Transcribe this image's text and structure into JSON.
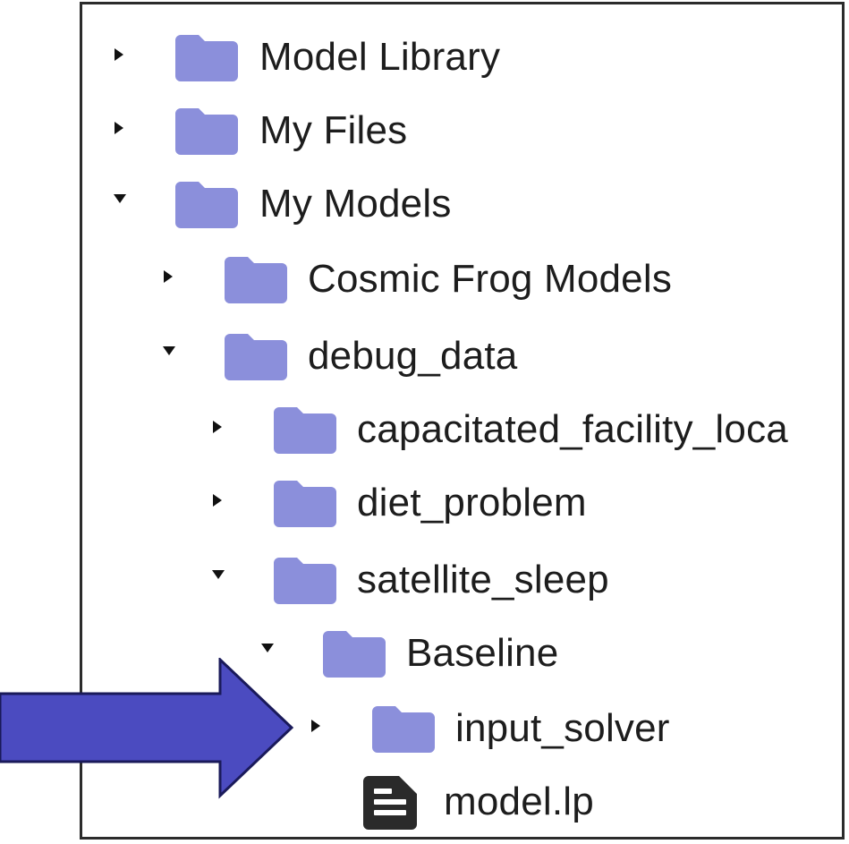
{
  "tree": {
    "items": [
      {
        "label": "Model Library",
        "icon": "folder-icon",
        "expanded": false
      },
      {
        "label": "My Files",
        "icon": "folder-icon",
        "expanded": false
      },
      {
        "label": "My Models",
        "icon": "folder-icon",
        "expanded": true
      },
      {
        "label": "Cosmic Frog Models",
        "icon": "folder-icon",
        "expanded": false
      },
      {
        "label": "debug_data",
        "icon": "folder-icon",
        "expanded": true
      },
      {
        "label": "capacitated_facility_loca",
        "icon": "folder-icon",
        "expanded": false
      },
      {
        "label": "diet_problem",
        "icon": "folder-icon",
        "expanded": false
      },
      {
        "label": "satellite_sleep",
        "icon": "folder-icon",
        "expanded": true
      },
      {
        "label": "Baseline",
        "icon": "folder-icon",
        "expanded": true
      },
      {
        "label": "input_solver",
        "icon": "folder-icon",
        "expanded": false
      },
      {
        "label": "model.lp",
        "icon": "file-document-icon"
      }
    ]
  },
  "colors": {
    "folder": "#8b8fdb",
    "text": "#1d1d1d",
    "arrow_fill": "#4b4bc0",
    "arrow_stroke": "#1a1a5a",
    "border": "#2b2b2b"
  }
}
